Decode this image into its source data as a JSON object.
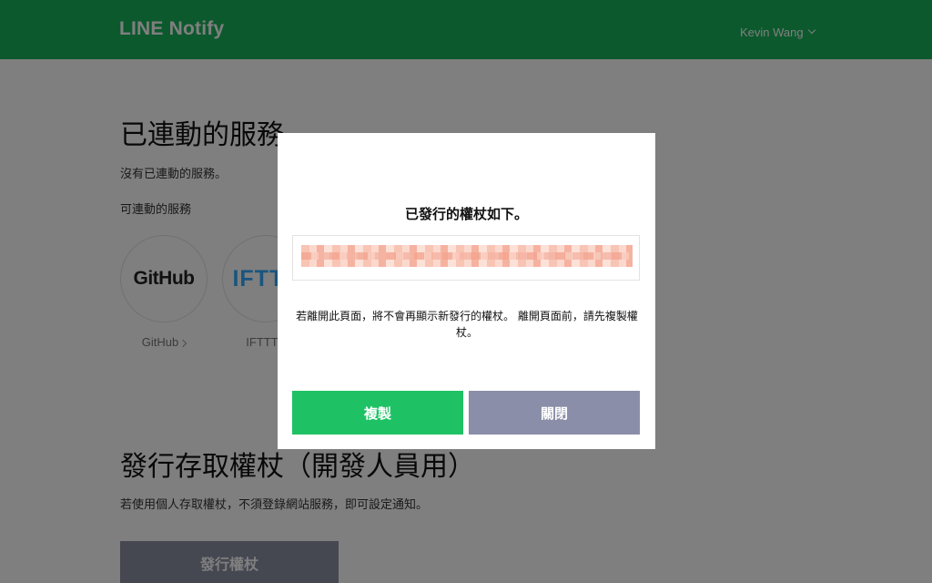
{
  "header": {
    "logo": "LINE Notify",
    "user_name": "Kevin Wang"
  },
  "linked_section": {
    "title": "已連動的服務",
    "empty_text": "沒有已連動的服務。",
    "available_label": "可連動的服務",
    "services": [
      {
        "logo_text": "GitHub",
        "label": "GitHub"
      },
      {
        "logo_text": "IFTTT",
        "label": "IFTTT"
      }
    ]
  },
  "token_section": {
    "title": "發行存取權杖（開發人員用）",
    "description": "若使用個人存取權杖，不須登錄網站服務，即可設定通知。",
    "issue_button": "發行權杖"
  },
  "modal": {
    "title": "已發行的權杖如下。",
    "token_value": "",
    "note": "若離開此頁面，將不會再顯示新發行的權杖。 離開頁面前，請先複製權杖。",
    "copy_button": "複製",
    "close_button": "關閉"
  },
  "colors": {
    "header_green": "#19b25a",
    "copy_green": "#1ec264",
    "close_gray": "#8a8ea8"
  }
}
